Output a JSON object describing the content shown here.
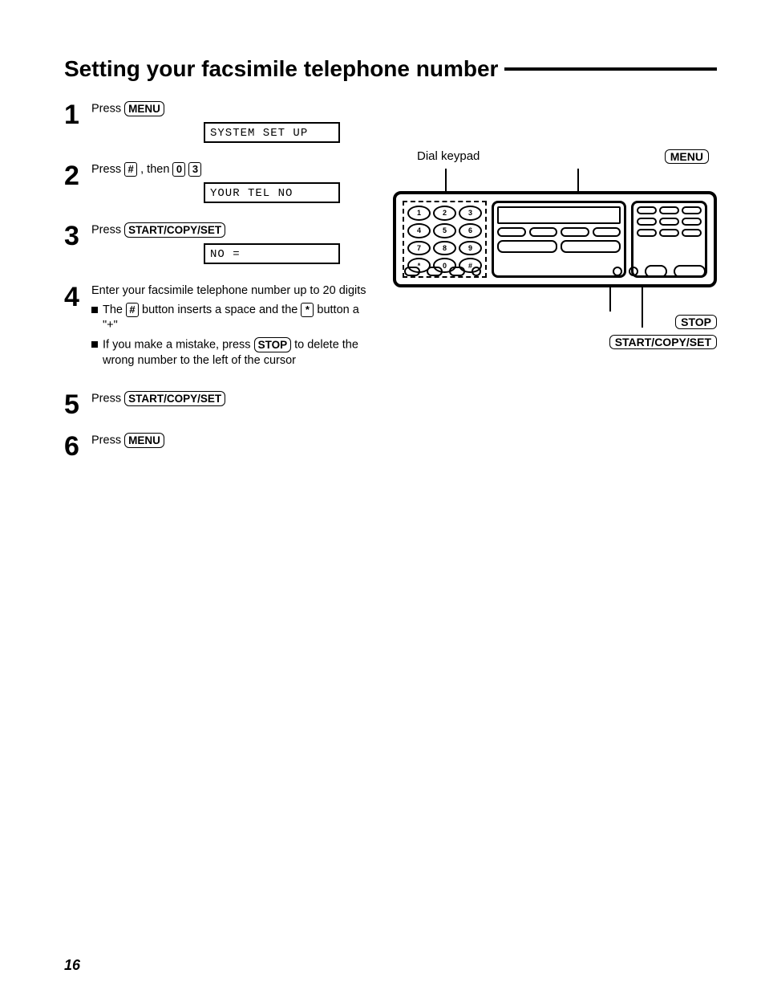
{
  "title": "Setting your facsimile telephone number",
  "steps": [
    {
      "num": "1",
      "pre": "Press ",
      "btn": "MENU",
      "lcd": "SYSTEM SET UP"
    },
    {
      "num": "2",
      "pre": "Press ",
      "key1": "#",
      "mid": ", then ",
      "key2": "0",
      "key3": "3",
      "lcd": "YOUR TEL NO"
    },
    {
      "num": "3",
      "pre": "Press ",
      "btn": "START/COPY/SET",
      "lcd": "NO ="
    },
    {
      "num": "4",
      "intro": "Enter your facsimile telephone number up to 20 digits",
      "b1_a": "The ",
      "b1_key1": "#",
      "b1_b": " button inserts a space and the ",
      "b1_key2": "*",
      "b1_c": " button a \"+\"",
      "b2_a": "If you make a mistake, press ",
      "b2_btn": "STOP",
      "b2_b": " to delete the wrong number to the left of the cursor"
    },
    {
      "num": "5",
      "pre": "Press ",
      "btn": "START/COPY/SET"
    },
    {
      "num": "6",
      "pre": "Press ",
      "btn": "MENU"
    }
  ],
  "diagram": {
    "label_keypad": "Dial keypad",
    "label_menu": "MENU",
    "keypad": [
      "1",
      "2",
      "3",
      "4",
      "5",
      "6",
      "7",
      "8",
      "9",
      "*",
      "0",
      "#"
    ],
    "label_stop": "STOP",
    "label_start": "START/COPY/SET"
  },
  "page_number": "16"
}
